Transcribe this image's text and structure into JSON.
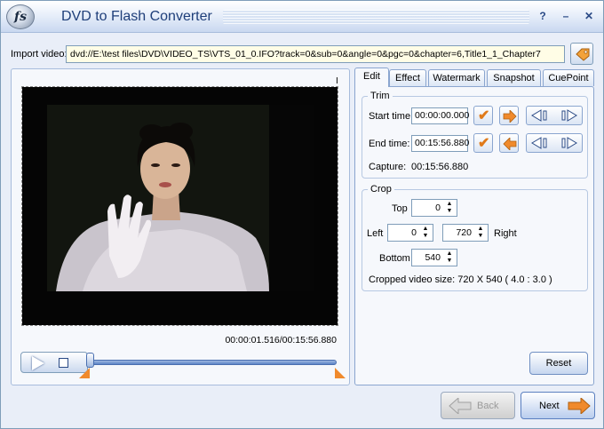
{
  "window": {
    "title": "DVD to Flash Converter",
    "logo_text": "fs",
    "controls": {
      "help": "?",
      "minimize": "–",
      "close": "✕"
    }
  },
  "import": {
    "label": "Import video:",
    "value": "dvd://E:\\test files\\DVD\\VIDEO_TS\\VTS_01_0.IFO?track=0&sub=0&angle=0&pgc=0&chapter=6,Title1_1_Chapter7",
    "browse_icon": "tag-icon"
  },
  "preview": {
    "corner_marker": "I",
    "timecode": "00:00:01.516/00:15:56.880",
    "progress": 0.0016
  },
  "tabs": [
    {
      "label": "Edit",
      "active": true
    },
    {
      "label": "Effect",
      "active": false
    },
    {
      "label": "Watermark",
      "active": false
    },
    {
      "label": "Snapshot",
      "active": false
    },
    {
      "label": "CuePoint",
      "active": false
    }
  ],
  "trim": {
    "title": "Trim",
    "start_label": "Start time:",
    "start_value": "00:00:00.000",
    "end_label": "End time:",
    "end_value": "00:15:56.880",
    "capture_label": "Capture:",
    "capture_value": "00:15:56.880"
  },
  "crop": {
    "title": "Crop",
    "top_label": "Top",
    "top_value": "0",
    "left_label": "Left",
    "left_value": "0",
    "right_label": "Right",
    "right_value": "720",
    "bottom_label": "Bottom",
    "bottom_value": "540",
    "size_text": "Cropped video size: 720 X 540  ( 4.0 : 3.0 )"
  },
  "buttons": {
    "reset": "Reset",
    "back": "Back",
    "next": "Next"
  },
  "colors": {
    "accent_orange": "#f08a2c",
    "title_blue": "#1f3f7a",
    "import_bg": "#fffde6"
  }
}
